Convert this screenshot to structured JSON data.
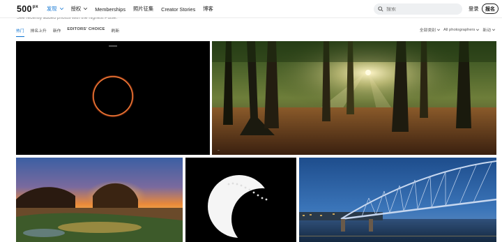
{
  "header": {
    "logo": "500",
    "logo_suffix": "px",
    "nav": [
      {
        "label": "发现",
        "active": true,
        "has_dropdown": true
      },
      {
        "label": "授权",
        "active": false,
        "has_dropdown": true
      },
      {
        "label": "Memberships",
        "active": false,
        "has_dropdown": false
      },
      {
        "label": "照片征集",
        "active": false,
        "has_dropdown": false
      },
      {
        "label": "Creator Stories",
        "active": false,
        "has_dropdown": false
      },
      {
        "label": "博客",
        "active": false,
        "has_dropdown": false
      }
    ],
    "search_placeholder": "搜索",
    "login_label": "登录",
    "signup_label": "报名",
    "search_icon": "search-icon"
  },
  "subtitle": "See recently added photos with the highest Pulse.",
  "tabs": [
    {
      "label": "热门",
      "active": true
    },
    {
      "label": "排名上升",
      "active": false
    },
    {
      "label": "新作",
      "active": false
    },
    {
      "label": "EDITORS' CHOICE",
      "active": false
    },
    {
      "label": "刷新",
      "active": false
    }
  ],
  "dropdowns": [
    {
      "label": "全部类别"
    },
    {
      "label": "All photographers"
    },
    {
      "label": "新动"
    }
  ],
  "photos": [
    {
      "name": "eclipse-ring-photo"
    },
    {
      "name": "forest-sunrays-photo"
    },
    {
      "name": "coastal-sunset-photo"
    },
    {
      "name": "solar-eclipse-sequence-photo"
    },
    {
      "name": "bridge-dusk-photo"
    }
  ],
  "colors": {
    "accent": "#0870d1",
    "search_bg": "#eef0f2"
  }
}
